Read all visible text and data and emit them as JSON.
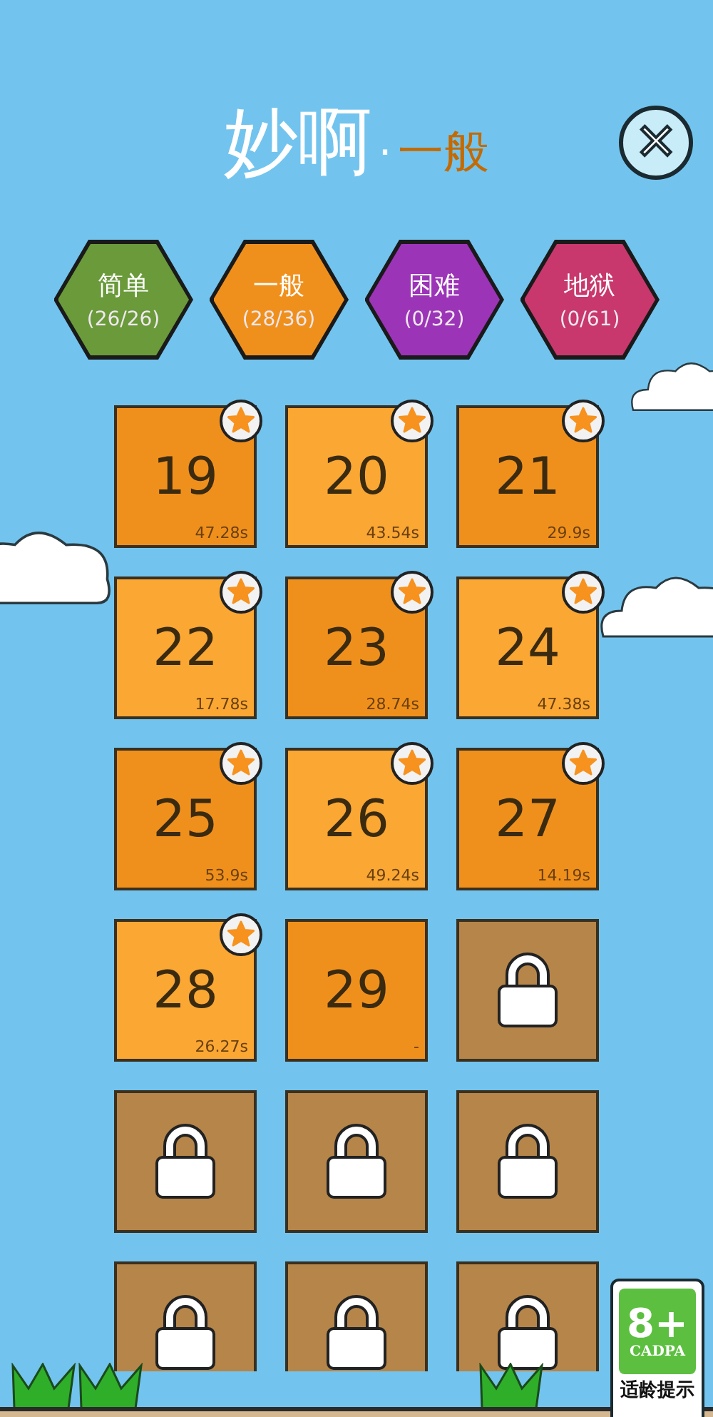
{
  "title": {
    "main": "妙啊",
    "separator": "·",
    "difficulty": "一般"
  },
  "close_button": {
    "icon": "×"
  },
  "tabs": [
    {
      "label": "简单",
      "progress": "(26/26)",
      "color": "#6a9a3a"
    },
    {
      "label": "一般",
      "progress": "(28/36)",
      "color": "#f0901c"
    },
    {
      "label": "困难",
      "progress": "(0/32)",
      "color": "#9c34b8"
    },
    {
      "label": "地狱",
      "progress": "(0/61)",
      "color": "#c8386c"
    }
  ],
  "levels": [
    {
      "kind": "level",
      "number": "19",
      "time": "47.28s",
      "starred": true
    },
    {
      "kind": "level",
      "number": "20",
      "time": "43.54s",
      "starred": true
    },
    {
      "kind": "level",
      "number": "21",
      "time": "29.9s",
      "starred": true
    },
    {
      "kind": "level",
      "number": "22",
      "time": "17.78s",
      "starred": true
    },
    {
      "kind": "level",
      "number": "23",
      "time": "28.74s",
      "starred": true
    },
    {
      "kind": "level",
      "number": "24",
      "time": "47.38s",
      "starred": true
    },
    {
      "kind": "level",
      "number": "25",
      "time": "53.9s",
      "starred": true
    },
    {
      "kind": "level",
      "number": "26",
      "time": "49.24s",
      "starred": true
    },
    {
      "kind": "level",
      "number": "27",
      "time": "14.19s",
      "starred": true
    },
    {
      "kind": "level",
      "number": "28",
      "time": "26.27s",
      "starred": true
    },
    {
      "kind": "level",
      "number": "29",
      "time": "-",
      "starred": false
    },
    {
      "kind": "locked"
    },
    {
      "kind": "locked"
    },
    {
      "kind": "locked"
    },
    {
      "kind": "locked"
    },
    {
      "kind": "locked"
    },
    {
      "kind": "locked"
    },
    {
      "kind": "locked"
    }
  ],
  "age_rating": {
    "age": "8+",
    "org": "CADPA",
    "caption": "适龄提示"
  }
}
